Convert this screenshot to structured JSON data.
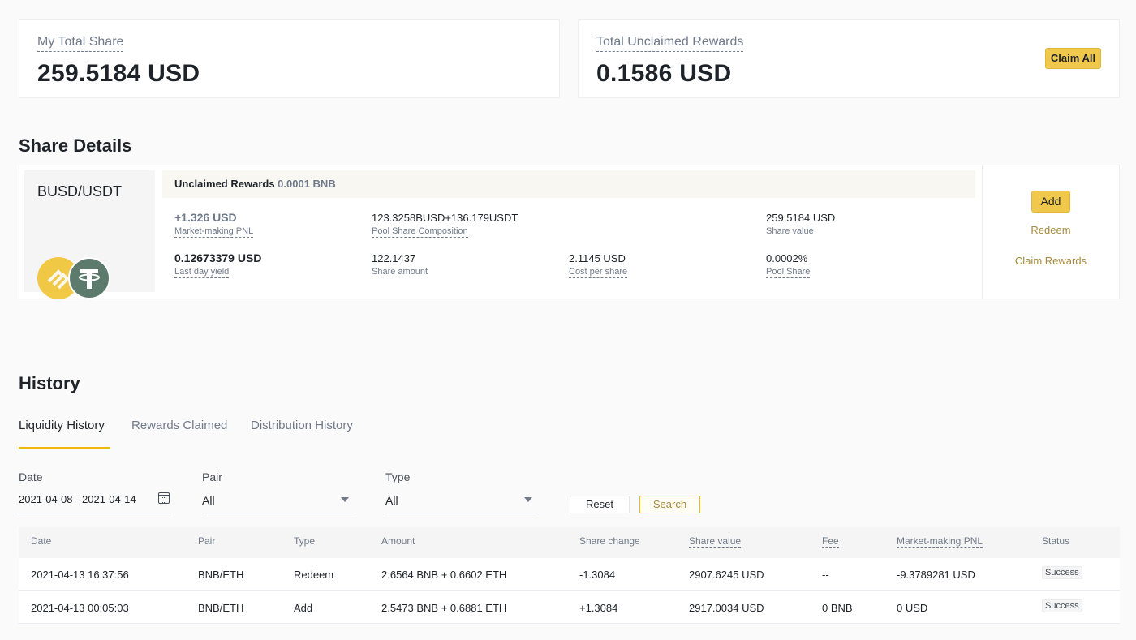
{
  "summary": {
    "my_total_share_label": "My Total Share",
    "my_total_share_value": "259.5184 USD",
    "total_unclaimed_label": "Total Unclaimed Rewards",
    "total_unclaimed_value": "0.1586 USD",
    "claim_all_label": "Claim All"
  },
  "share_details": {
    "title": "Share Details",
    "pair": "BUSD/USDT",
    "coin_icons": [
      "busd-icon",
      "usdt-icon"
    ],
    "unclaimed_label": "Unclaimed Rewards",
    "unclaimed_value": "0.0001 BNB",
    "metrics": {
      "pnl_value": "+1.326 USD",
      "pnl_label": "Market-making PNL",
      "composition_value": "123.3258BUSD+136.179USDT",
      "composition_label": "Pool Share Composition",
      "share_value_value": "259.5184 USD",
      "share_value_label": "Share value",
      "yield_value": "0.12673379 USD",
      "yield_label": "Last day yield",
      "share_amount_value": "122.1437",
      "share_amount_label": "Share amount",
      "cost_value": "2.1145 USD",
      "cost_label": "Cost per share",
      "pool_share_value": "0.0002%",
      "pool_share_label": "Pool Share"
    },
    "actions": {
      "add": "Add",
      "redeem": "Redeem",
      "claim_rewards": "Claim Rewards"
    }
  },
  "history": {
    "title": "History",
    "tabs": [
      {
        "label": "Liquidity History",
        "active": true
      },
      {
        "label": "Rewards Claimed",
        "active": false
      },
      {
        "label": "Distribution History",
        "active": false
      }
    ],
    "filters": {
      "date_label": "Date",
      "date_value": "2021-04-08 - 2021-04-14",
      "pair_label": "Pair",
      "pair_value": "All",
      "type_label": "Type",
      "type_value": "All",
      "reset_label": "Reset",
      "search_label": "Search"
    },
    "columns": [
      "Date",
      "Pair",
      "Type",
      "Amount",
      "Share change",
      "Share value",
      "Fee",
      "Market-making PNL",
      "Status"
    ],
    "rows": [
      {
        "date": "2021-04-13 16:37:56",
        "pair": "BNB/ETH",
        "type": "Redeem",
        "amount": "2.6564 BNB + 0.6602 ETH",
        "share_change": "-1.3084",
        "share_value": "2907.6245 USD",
        "fee": "--",
        "pnl": "-9.3789281 USD",
        "status": "Success"
      },
      {
        "date": "2021-04-13 00:05:03",
        "pair": "BNB/ETH",
        "type": "Add",
        "amount": "2.5473 BNB + 0.6881 ETH",
        "share_change": "+1.3084",
        "share_value": "2917.0034 USD",
        "fee": "0 BNB",
        "pnl": "0 USD",
        "status": "Success"
      }
    ]
  },
  "colors": {
    "accent": "#f0b90b",
    "button_gold": "#f0c94c",
    "text_primary": "#1e2329",
    "text_secondary": "#707a8a",
    "background": "#fafafa"
  }
}
